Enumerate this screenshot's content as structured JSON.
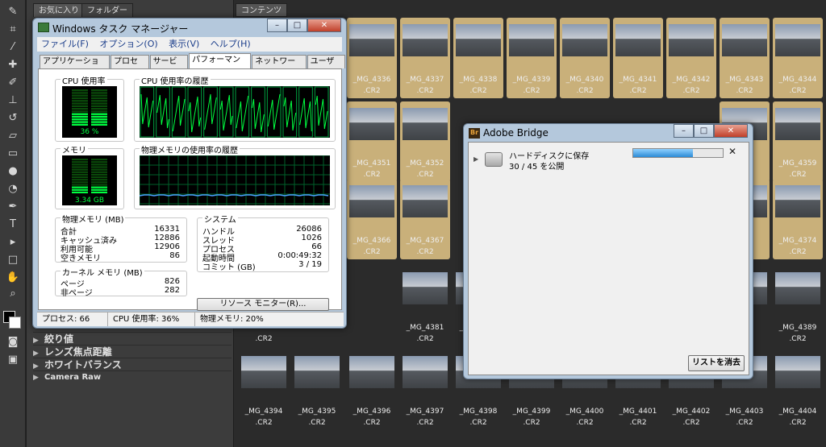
{
  "bridge_panels": {
    "favorites_tab": "お気に入り",
    "folders_tab": "フォルダー",
    "content_tab": "コンテンツ",
    "filters": [
      "絞り値",
      "レンズ焦点距離",
      "ホワイトバランス",
      "Camera Raw"
    ]
  },
  "thumbnails": {
    "row1": [
      {
        "name": "_MG_4336",
        "ext": ".CR2"
      },
      {
        "name": "_MG_4337",
        "ext": ".CR2"
      },
      {
        "name": "_MG_4338",
        "ext": ".CR2"
      },
      {
        "name": "_MG_4339",
        "ext": ".CR2"
      },
      {
        "name": "_MG_4340",
        "ext": ".CR2"
      },
      {
        "name": "_MG_4341",
        "ext": ".CR2"
      },
      {
        "name": "_MG_4342",
        "ext": ".CR2"
      },
      {
        "name": "_MG_4343",
        "ext": ".CR2"
      },
      {
        "name": "_MG_4344",
        "ext": ".CR2"
      }
    ],
    "row2": [
      {
        "name": "_MG_4351",
        "ext": ".CR2"
      },
      {
        "name": "_MG_4352",
        "ext": ".CR2"
      },
      {
        "name": "58",
        "ext": ".CR2"
      },
      {
        "name": "_MG_4359",
        "ext": ".CR2"
      }
    ],
    "row3": [
      {
        "name": "_MG_4366",
        "ext": ".CR2"
      },
      {
        "name": "_MG_4367",
        "ext": ".CR2"
      },
      {
        "name": "73",
        "ext": ".CR2"
      },
      {
        "name": "_MG_4374",
        "ext": ".CR2"
      }
    ],
    "row4": [
      {
        "name": "",
        "ext": ".CR2"
      },
      {
        "name": "_MG_4381",
        "ext": ".CR2"
      },
      {
        "name": "_MG_4382",
        "ext": ".CR2"
      },
      {
        "name": "88",
        "ext": ".CR2"
      },
      {
        "name": "_MG_4389",
        "ext": ".CR2"
      }
    ],
    "row5": [
      {
        "name": "_MG_4394",
        "ext": ".CR2"
      },
      {
        "name": "_MG_4395",
        "ext": ".CR2"
      },
      {
        "name": "_MG_4396",
        "ext": ".CR2"
      },
      {
        "name": "_MG_4397",
        "ext": ".CR2"
      },
      {
        "name": "_MG_4398",
        "ext": ".CR2"
      },
      {
        "name": "_MG_4399",
        "ext": ".CR2"
      },
      {
        "name": "_MG_4400",
        "ext": ".CR2"
      },
      {
        "name": "_MG_4401",
        "ext": ".CR2"
      },
      {
        "name": "_MG_4402",
        "ext": ".CR2"
      },
      {
        "name": "_MG_4403",
        "ext": ".CR2"
      },
      {
        "name": "_MG_4404",
        "ext": ".CR2"
      }
    ]
  },
  "task_manager": {
    "title": "Windows タスク マネージャー",
    "menu": [
      "ファイル(F)",
      "オプション(O)",
      "表示(V)",
      "ヘルプ(H)"
    ],
    "tabs": [
      "アプリケーション",
      "プロセス",
      "サービス",
      "パフォーマンス",
      "ネットワーク",
      "ユーザー"
    ],
    "active_tab_index": 3,
    "cpu_usage_label": "CPU 使用率",
    "cpu_usage_value": "36 %",
    "cpu_usage_fraction": 0.36,
    "cpu_history_label": "CPU 使用率の履歴",
    "memory_label": "メモリ",
    "memory_value": "3.34 GB",
    "memory_fraction": 0.2,
    "memory_history_label": "物理メモリの使用率の履歴",
    "physical_memory": {
      "label": "物理メモリ (MB)",
      "rows": [
        {
          "k": "合計",
          "v": "16331"
        },
        {
          "k": "キャッシュ済み",
          "v": "12886"
        },
        {
          "k": "利用可能",
          "v": "12906"
        },
        {
          "k": "空きメモリ",
          "v": "86"
        }
      ]
    },
    "kernel_memory": {
      "label": "カーネル メモリ (MB)",
      "rows": [
        {
          "k": "ページ",
          "v": "826"
        },
        {
          "k": "非ページ",
          "v": "282"
        }
      ]
    },
    "system": {
      "label": "システム",
      "rows": [
        {
          "k": "ハンドル",
          "v": "26086"
        },
        {
          "k": "スレッド",
          "v": "1026"
        },
        {
          "k": "プロセス",
          "v": "66"
        },
        {
          "k": "起動時間",
          "v": "0:00:49:32"
        },
        {
          "k": "コミット (GB)",
          "v": "3 / 19"
        }
      ]
    },
    "resource_monitor_button": "リソース モニター(R)...",
    "status": {
      "processes": "プロセス: 66",
      "cpu": "CPU 使用率: 36%",
      "memory": "物理メモリ: 20%"
    }
  },
  "bridge_dialog": {
    "title": "Adobe Bridge",
    "icon_text": "Br",
    "task_name": "ハードディスクに保存",
    "task_progress": "30 / 45 を公開",
    "progress_fraction": 0.6667,
    "clear_button": "リストを消去"
  },
  "colors": {
    "accent_selected": "#c9b07a",
    "graph_green": "#00ff40",
    "progress_blue": "#2b8ad6"
  }
}
